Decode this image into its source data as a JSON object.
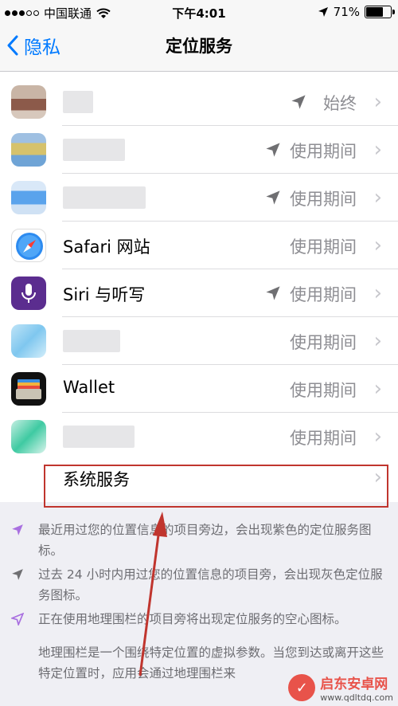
{
  "status_bar": {
    "carrier": "中国联通",
    "time": "下午4:01",
    "battery": "71%",
    "battery_level": 0.71
  },
  "nav": {
    "back_label": "隐私",
    "title": "定位服务"
  },
  "rows": [
    {
      "name": "",
      "status": "始终",
      "arrow": "gray",
      "icon": "blurred-app-icon"
    },
    {
      "name": "",
      "status": "使用期间",
      "arrow": "gray",
      "icon": "blurred-app-icon"
    },
    {
      "name": "",
      "status": "使用期间",
      "arrow": "gray",
      "icon": "blurred-app-icon"
    },
    {
      "name": "Safari 网站",
      "status": "使用期间",
      "arrow": "none",
      "icon": "safari-icon"
    },
    {
      "name": "Siri 与听写",
      "status": "使用期间",
      "arrow": "gray",
      "icon": "siri-icon"
    },
    {
      "name": "",
      "status": "使用期间",
      "arrow": "none",
      "icon": "blurred-app-icon"
    },
    {
      "name": "Wallet",
      "status": "使用期间",
      "arrow": "none",
      "icon": "wallet-icon"
    },
    {
      "name": "",
      "status": "使用期间",
      "arrow": "none",
      "icon": "blurred-app-icon"
    }
  ],
  "system_services": {
    "label": "系统服务"
  },
  "notes": {
    "purple": "最近用过您的位置信息的项目旁边，会出现紫色的定位服务图标。",
    "gray": "过去 24 小时内用过您的位置信息的项目旁，会出现灰色定位服务图标。",
    "outline": "正在使用地理围栏的项目旁将出现定位服务的空心图标。",
    "geofence": "地理围栏是一个围绕特定位置的虚拟参数。当您到达或离开这些特定位置时，应用会通过地理围栏来"
  },
  "watermark": {
    "title": "启东安卓网",
    "url": "www.qdltdq.com"
  },
  "colors": {
    "accent": "#007aff",
    "purple": "#a970e0",
    "gray_arrow": "#6f6f72",
    "highlight": "#c0352e"
  }
}
